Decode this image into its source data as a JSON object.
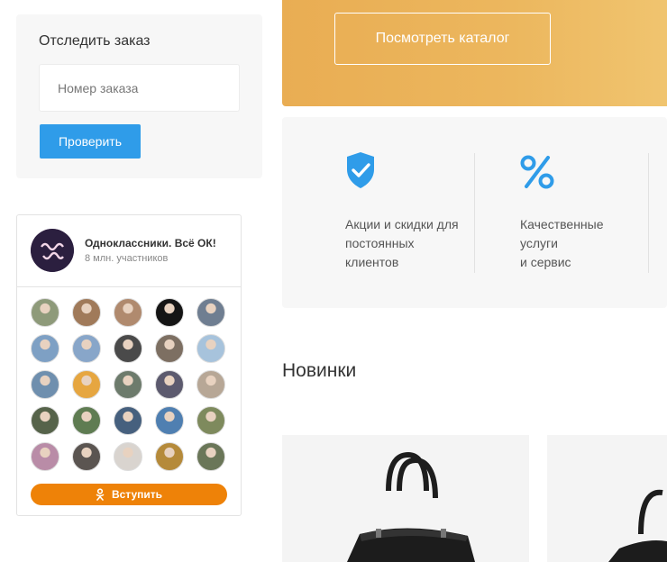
{
  "track": {
    "title": "Отследить заказ",
    "input_placeholder": "Номер заказа",
    "button_label": "Проверить"
  },
  "ok_widget": {
    "group_name": "Одноклассники. Всё ОК!",
    "members": "8 млн. участников",
    "join_label": "Вступить",
    "brand_color": "#ee8208",
    "member_colors": [
      "#8e9a7a",
      "#a07a5a",
      "#b08a6e",
      "#151515",
      "#6f7e91",
      "#7ea0c4",
      "#88a6c9",
      "#4a4a4a",
      "#7d6f62",
      "#a7c3dc",
      "#6f8fae",
      "#e6a640",
      "#6d7b6c",
      "#5c5a6e",
      "#b7a796",
      "#56634a",
      "#5f7c52",
      "#46607e",
      "#4f7fb1",
      "#7e8a5d",
      "#b98ca7",
      "#5b5551",
      "#d9d4cf",
      "#b58a3a",
      "#6a7658"
    ]
  },
  "banner": {
    "catalog_button": "Посмотреть каталог",
    "color": "#e9ad53"
  },
  "features": [
    {
      "icon": "shield-check-icon",
      "text": "Акции и скидки для\nпостоянных\nклиентов"
    },
    {
      "icon": "percent-icon",
      "text": "Качественные\nуслуги\nи сервис"
    }
  ],
  "new_section": {
    "title": "Новинки"
  },
  "accent_color": "#2f9ce9"
}
